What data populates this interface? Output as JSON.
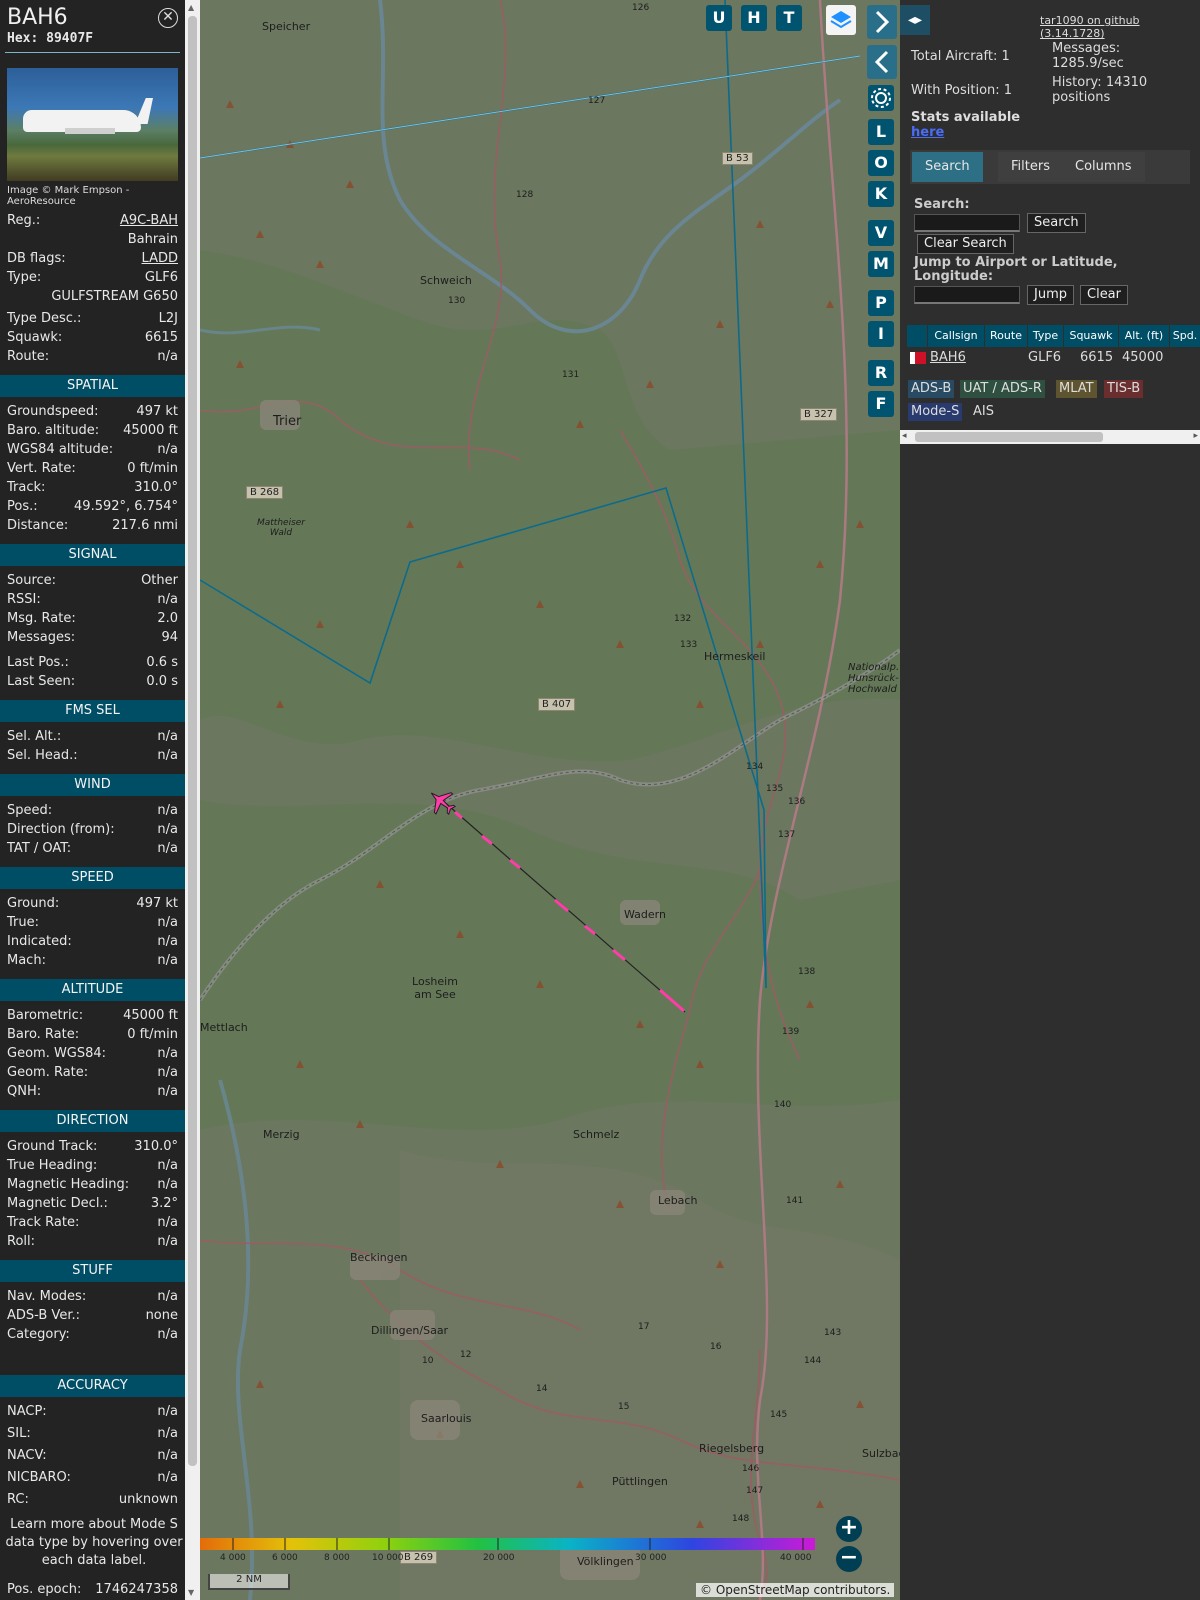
{
  "aircraft": {
    "callsign": "BAH6",
    "hex": "Hex: 89407F",
    "photo_credit": "Image © Mark Empson - AeroResource"
  },
  "info_rows_top": [
    {
      "k": "Reg.:",
      "v": "A9C-BAH",
      "link": true
    },
    {
      "k": "",
      "v": "Bahrain"
    },
    {
      "k": "DB flags:",
      "v": "LADD",
      "link": true
    },
    {
      "k": "Type:",
      "v": "GLF6"
    },
    {
      "k": "",
      "v": "GULFSTREAM G650"
    },
    {
      "k": "Type Desc.:",
      "v": "L2J"
    },
    {
      "k": "Squawk:",
      "v": "6615"
    },
    {
      "k": "Route:",
      "v": "n/a"
    }
  ],
  "sections": [
    {
      "title": "SPATIAL",
      "rows": [
        {
          "k": "Groundspeed:",
          "v": "497 kt"
        },
        {
          "k": "Baro. altitude:",
          "v": "45000 ft"
        },
        {
          "k": "WGS84 altitude:",
          "v": "n/a"
        },
        {
          "k": "Vert. Rate:",
          "v": "0 ft/min"
        },
        {
          "k": "Track:",
          "v": "310.0°"
        },
        {
          "k": "Pos.:",
          "v": "49.592°, 6.754°"
        },
        {
          "k": "Distance:",
          "v": "217.6 nmi"
        }
      ]
    },
    {
      "title": "SIGNAL",
      "rows": [
        {
          "k": "Source:",
          "v": "Other"
        },
        {
          "k": "RSSI:",
          "v": "n/a"
        },
        {
          "k": "Msg. Rate:",
          "v": "2.0"
        },
        {
          "k": "Messages:",
          "v": "94"
        },
        {
          "k": "Last Pos.:",
          "v": "0.6 s"
        },
        {
          "k": "Last Seen:",
          "v": "0.0 s"
        }
      ]
    },
    {
      "title": "FMS SEL",
      "rows": [
        {
          "k": "Sel. Alt.:",
          "v": "n/a"
        },
        {
          "k": "Sel. Head.:",
          "v": "n/a"
        }
      ]
    },
    {
      "title": "WIND",
      "rows": [
        {
          "k": "Speed:",
          "v": "n/a"
        },
        {
          "k": "Direction (from):",
          "v": "n/a"
        },
        {
          "k": "TAT / OAT:",
          "v": "n/a"
        }
      ]
    },
    {
      "title": "SPEED",
      "rows": [
        {
          "k": "Ground:",
          "v": "497 kt"
        },
        {
          "k": "True:",
          "v": "n/a"
        },
        {
          "k": "Indicated:",
          "v": "n/a"
        },
        {
          "k": "Mach:",
          "v": "n/a"
        }
      ]
    },
    {
      "title": "ALTITUDE",
      "rows": [
        {
          "k": "Barometric:",
          "v": "45000 ft"
        },
        {
          "k": "Baro. Rate:",
          "v": "0 ft/min"
        },
        {
          "k": "Geom. WGS84:",
          "v": "n/a"
        },
        {
          "k": "Geom. Rate:",
          "v": "n/a"
        },
        {
          "k": "QNH:",
          "v": "n/a"
        }
      ]
    },
    {
      "title": "DIRECTION",
      "rows": [
        {
          "k": "Ground Track:",
          "v": "310.0°"
        },
        {
          "k": "True Heading:",
          "v": "n/a"
        },
        {
          "k": "Magnetic Heading:",
          "v": "n/a"
        },
        {
          "k": "Magnetic Decl.:",
          "v": "3.2°"
        },
        {
          "k": "Track Rate:",
          "v": "n/a"
        },
        {
          "k": "Roll:",
          "v": "n/a"
        }
      ]
    },
    {
      "title": "STUFF",
      "rows": [
        {
          "k": "Nav. Modes:",
          "v": "n/a"
        },
        {
          "k": "ADS-B Ver.:",
          "v": "none"
        },
        {
          "k": "Category:",
          "v": "n/a"
        }
      ]
    },
    {
      "title": "ACCURACY",
      "rows": [
        {
          "k": "NACP:",
          "v": "n/a"
        },
        {
          "k": "SIL:",
          "v": "n/a"
        },
        {
          "k": "NACV:",
          "v": "n/a"
        },
        {
          "k": "NICBARO:",
          "v": "n/a"
        },
        {
          "k": "RC:",
          "v": "unknown"
        }
      ]
    }
  ],
  "learn_more": "Learn more about Mode S data type by hovering over each data label.",
  "pos_epoch": {
    "k": "Pos. epoch:",
    "v": "1746247358"
  },
  "map": {
    "place_labels": [
      "Speicher",
      "Schweich",
      "Trier",
      "Mattheiser Wald",
      "Hermeskeil",
      "Nationalp. Hunsrück-Hochwald",
      "Wadern",
      "Losheim am See",
      "Mettlach",
      "Merzig",
      "Schmelz",
      "Lebach",
      "Beckingen",
      "Dillingen/Saar",
      "Saarlouis",
      "Riegelsberg",
      "Sulzbach",
      "Püttlingen",
      "Völklingen"
    ],
    "road_labels": [
      "B 53",
      "B 327",
      "B 268",
      "B 407",
      "B 269"
    ],
    "km_markers": [
      "126",
      "127",
      "128",
      "130",
      "131",
      "132",
      "133",
      "134",
      "135",
      "136",
      "137",
      "138",
      "139",
      "140",
      "141",
      "143",
      "144",
      "145",
      "146",
      "147",
      "148",
      "10",
      "12",
      "14",
      "15",
      "16",
      "17"
    ],
    "buttons_col1": [
      "U",
      "H",
      "T"
    ],
    "buttons_col2": [
      "L",
      "O",
      "K",
      "V",
      "M",
      "P",
      "I",
      "R",
      "F"
    ],
    "legend_ticks": [
      "4 000",
      "6 000",
      "8 000",
      "10 000",
      "20 000",
      "30 000",
      "40 000"
    ],
    "scale": "2 NM",
    "attribution": "© OpenStreetMap contributors."
  },
  "side": {
    "github": "tar1090 on github (3.14.1728)",
    "total_aircraft": "Total Aircraft: 1",
    "with_position": "With Position: 1",
    "messages": "Messages:",
    "messages_val": "1285.9/sec",
    "history": "History: 14310",
    "history_val": "positions",
    "stats": "Stats available",
    "here": "here",
    "tabs": [
      "Search",
      "Filters",
      "Columns"
    ],
    "search_label": "Search:",
    "search_btn": "Search",
    "clear_search_btn": "Clear Search",
    "jump_label": "Jump to Airport or Latitude, Longitude:",
    "jump_btn": "Jump",
    "clear_btn": "Clear",
    "table_headers": [
      "Callsign",
      "Route",
      "Type",
      "Squawk",
      "Alt. (ft)",
      "Spd."
    ],
    "table_row": {
      "callsign": "BAH6",
      "route": "",
      "type": "GLF6",
      "squawk": "6615",
      "alt": "45000"
    },
    "badges": [
      "ADS-B",
      "UAT / ADS-R",
      "MLAT",
      "TIS-B",
      "Mode-S",
      "AIS"
    ]
  },
  "colors": {
    "section_bg": "#004d66",
    "track": "#ff3ca8",
    "route": "#0c6b8c"
  }
}
